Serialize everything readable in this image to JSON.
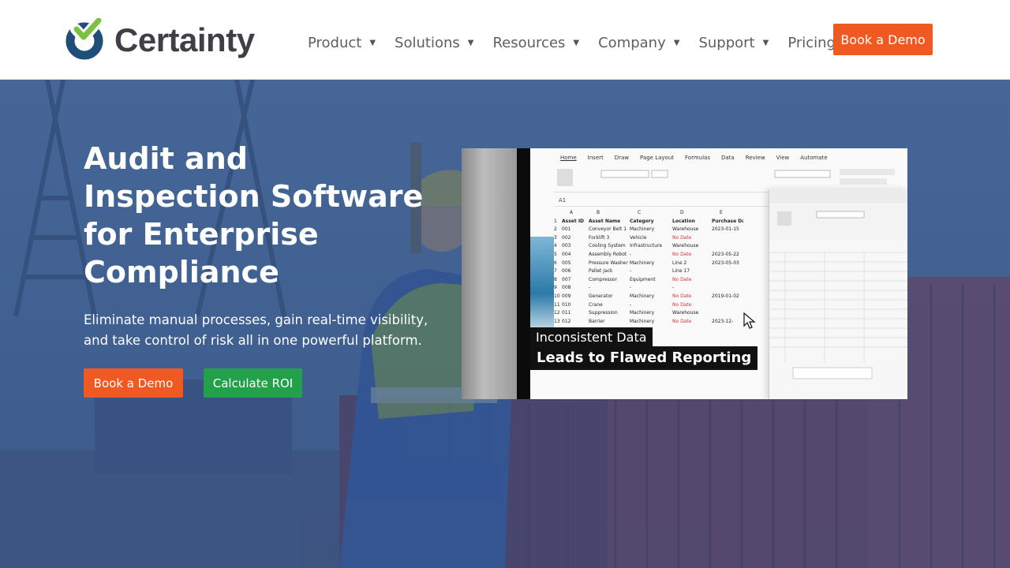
{
  "brand": {
    "name": "Certainty",
    "colors": {
      "navy": "#1f4e79",
      "green": "#7cc242",
      "orange": "#f05a22",
      "cta_green": "#23a04a"
    }
  },
  "nav": {
    "items": [
      {
        "label": "Product",
        "has_dropdown": true
      },
      {
        "label": "Solutions",
        "has_dropdown": true
      },
      {
        "label": "Resources",
        "has_dropdown": true
      },
      {
        "label": "Company",
        "has_dropdown": true
      },
      {
        "label": "Support",
        "has_dropdown": true
      },
      {
        "label": "Pricing",
        "has_dropdown": false
      }
    ],
    "cta_label": "Book a Demo"
  },
  "hero": {
    "title": "Audit and Inspection Software for Enterprise Compliance",
    "subtitle": "Eliminate manual processes, gain real-time visibility, and take control of risk all in one powerful platform.",
    "primary_cta": "Book a Demo",
    "secondary_cta": "Calculate ROI"
  },
  "video": {
    "caption_line1": "Inconsistent Data",
    "caption_line2": "Leads to Flawed Reporting",
    "sheet_tabs": [
      "Home",
      "Insert",
      "Draw",
      "Page Layout",
      "Formulas",
      "Data",
      "Review",
      "View",
      "Automate"
    ],
    "formula_cell": "A1",
    "columns": [
      "A",
      "B",
      "C",
      "D",
      "E"
    ],
    "headers": [
      "Asset ID",
      "Asset Name",
      "Category",
      "Location",
      "Purchase Date"
    ],
    "rows": [
      [
        "001",
        "Conveyor Belt 1",
        "Machinery",
        "Warehouse",
        "2023-01-15"
      ],
      [
        "002",
        "Forklift 3",
        "Vehicle",
        "No Date",
        ""
      ],
      [
        "003",
        "Cooling System",
        "Infrastructure",
        "Warehouse",
        ""
      ],
      [
        "004",
        "Assembly Robot",
        "-",
        "No Date",
        "2023-05-22"
      ],
      [
        "005",
        "Pressure Washer",
        "Machinery",
        "Line 2",
        "2023-05-03"
      ],
      [
        "006",
        "Pallet Jack",
        "-",
        "Line 17",
        ""
      ],
      [
        "007",
        "Compressor",
        "Equipment",
        "No Date",
        ""
      ],
      [
        "008",
        "-",
        "-",
        "-",
        ""
      ],
      [
        "009",
        "Generator",
        "Machinery",
        "No Date",
        "2019-01-02"
      ],
      [
        "010",
        "Crane",
        "-",
        "No Date",
        ""
      ],
      [
        "011",
        "Suppression",
        "Machinery",
        "Warehouse",
        ""
      ],
      [
        "012",
        "Barrier",
        "Machinery",
        "No Date",
        "2023-12-"
      ]
    ]
  }
}
